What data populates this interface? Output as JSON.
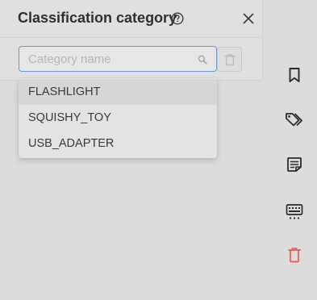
{
  "panel": {
    "title": "Classification category",
    "search": {
      "placeholder": "Category name",
      "value": ""
    },
    "options": [
      "FLASHLIGHT",
      "SQUISHY_TOY",
      "USB_ADAPTER"
    ]
  },
  "sidebar": {
    "icons": [
      "bookmark-icon",
      "tags-icon",
      "note-icon",
      "keyboard-icon",
      "trash-icon"
    ]
  },
  "colors": {
    "accent_border": "#6d96cf",
    "danger": "#e05a5a",
    "icon": "#2b2b2b"
  }
}
